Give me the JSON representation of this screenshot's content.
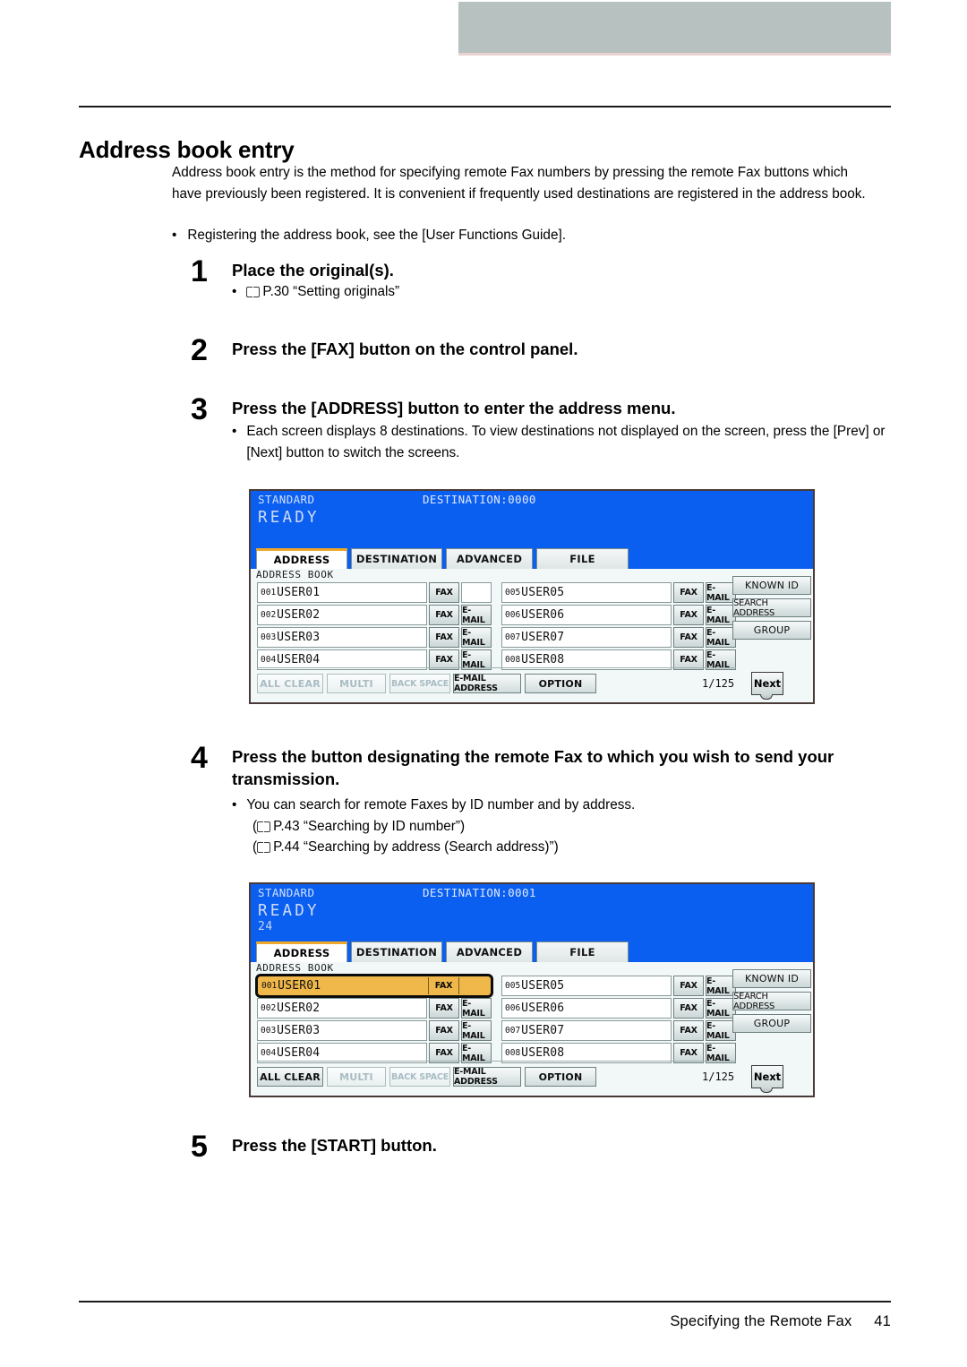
{
  "footer": {
    "label": "Specifying the Remote Fax",
    "page": "41"
  },
  "heading": "Address book entry",
  "intro": "Address book entry is the method for specifying remote Fax numbers by pressing the remote Fax buttons which have previously been registered. It is convenient if frequently used destinations are registered in the address book.",
  "intro_bullet": {
    "dot": "•",
    "text": "Registering the address book, see the [User Functions Guide]."
  },
  "steps": [
    {
      "num": "1",
      "title": "Place the original(s).",
      "bullets": [
        {
          "dot": "•",
          "ref": "P.30 “Setting originals”",
          "has_book": true
        }
      ]
    },
    {
      "num": "2",
      "title": "Press the [FAX] button on the control panel.",
      "bullets": []
    },
    {
      "num": "3",
      "title": "Press the [ADDRESS] button to enter the address menu.",
      "bullets": [
        {
          "dot": "•",
          "ref": "Each screen displays 8 destinations. To view destinations not displayed on the screen, press the [Prev] or [Next] button to switch the screens.",
          "has_book": false
        }
      ]
    },
    {
      "num": "4",
      "title": "Press the button designating the remote Fax to which you wish to send your transmission.",
      "bullets": [
        {
          "dot": "•",
          "ref": "You can search for remote Faxes by ID number and by address.",
          "has_book": false
        },
        {
          "dot": "",
          "ref": "P.43 “Searching by ID number”",
          "has_book": true,
          "paren": true
        },
        {
          "dot": "",
          "ref": "P.44 “Searching by address (Search address)”",
          "has_book": true,
          "paren": true
        }
      ]
    },
    {
      "num": "5",
      "title": "Press the [START] button.",
      "bullets": []
    }
  ],
  "colors": {
    "lcd_blue": "#0a5ef0",
    "lcd_face": "#f2f7f7",
    "tab_accent": "#f0a829",
    "selection": "#f0b74a",
    "header_bar": "#b6c1c0"
  },
  "panels": [
    {
      "status_left": "STANDARD",
      "destination": "DESTINATION:0000",
      "ready": "READY",
      "counter": "",
      "address_book_label": "ADDRESS BOOK",
      "tabs": [
        {
          "label": "ADDRESS",
          "active": true
        },
        {
          "label": "DESTINATION",
          "active": false
        },
        {
          "label": "ADVANCED",
          "active": false
        },
        {
          "label": "FILE",
          "active": false
        }
      ],
      "entries": [
        {
          "num": "001",
          "name": "USER01",
          "fax": "FAX",
          "email": "",
          "selected": false
        },
        {
          "num": "002",
          "name": "USER02",
          "fax": "FAX",
          "email": "E-MAIL",
          "selected": false
        },
        {
          "num": "003",
          "name": "USER03",
          "fax": "FAX",
          "email": "E-MAIL",
          "selected": false
        },
        {
          "num": "004",
          "name": "USER04",
          "fax": "FAX",
          "email": "E-MAIL",
          "selected": false
        },
        {
          "num": "005",
          "name": "USER05",
          "fax": "FAX",
          "email": "E-MAIL",
          "selected": false
        },
        {
          "num": "006",
          "name": "USER06",
          "fax": "FAX",
          "email": "E-MAIL",
          "selected": false
        },
        {
          "num": "007",
          "name": "USER07",
          "fax": "FAX",
          "email": "E-MAIL",
          "selected": false
        },
        {
          "num": "008",
          "name": "USER08",
          "fax": "FAX",
          "email": "E-MAIL",
          "selected": false
        }
      ],
      "side_buttons": [
        {
          "label": "KNOWN ID",
          "tight": false
        },
        {
          "label": "SEARCH ADDRESS",
          "tight": true
        },
        {
          "label": "GROUP",
          "tight": false
        }
      ],
      "toolbar": [
        {
          "label": "ALL CLEAR",
          "disabled": true,
          "small": false
        },
        {
          "label": "MULTI",
          "disabled": true,
          "small": false
        },
        {
          "label": "BACK SPACE",
          "disabled": true,
          "small": true
        },
        {
          "label": "E-MAIL ADDRESS",
          "disabled": false,
          "small": true
        },
        {
          "label": "OPTION",
          "disabled": false,
          "small": false
        }
      ],
      "page_indicator": "1/125",
      "next_label": "Next"
    },
    {
      "status_left": "STANDARD",
      "destination": "DESTINATION:0001",
      "ready": "READY",
      "counter": "24",
      "address_book_label": "ADDRESS BOOK",
      "tabs": [
        {
          "label": "ADDRESS",
          "active": true
        },
        {
          "label": "DESTINATION",
          "active": false
        },
        {
          "label": "ADVANCED",
          "active": false
        },
        {
          "label": "FILE",
          "active": false
        }
      ],
      "entries": [
        {
          "num": "001",
          "name": "USER01",
          "fax": "FAX",
          "email": "",
          "selected": true
        },
        {
          "num": "002",
          "name": "USER02",
          "fax": "FAX",
          "email": "E-MAIL",
          "selected": false
        },
        {
          "num": "003",
          "name": "USER03",
          "fax": "FAX",
          "email": "E-MAIL",
          "selected": false
        },
        {
          "num": "004",
          "name": "USER04",
          "fax": "FAX",
          "email": "E-MAIL",
          "selected": false
        },
        {
          "num": "005",
          "name": "USER05",
          "fax": "FAX",
          "email": "E-MAIL",
          "selected": false
        },
        {
          "num": "006",
          "name": "USER06",
          "fax": "FAX",
          "email": "E-MAIL",
          "selected": false
        },
        {
          "num": "007",
          "name": "USER07",
          "fax": "FAX",
          "email": "E-MAIL",
          "selected": false
        },
        {
          "num": "008",
          "name": "USER08",
          "fax": "FAX",
          "email": "E-MAIL",
          "selected": false
        }
      ],
      "side_buttons": [
        {
          "label": "KNOWN ID",
          "tight": false
        },
        {
          "label": "SEARCH ADDRESS",
          "tight": true
        },
        {
          "label": "GROUP",
          "tight": false
        }
      ],
      "toolbar": [
        {
          "label": "ALL CLEAR",
          "disabled": false,
          "small": false
        },
        {
          "label": "MULTI",
          "disabled": true,
          "small": false
        },
        {
          "label": "BACK SPACE",
          "disabled": true,
          "small": true
        },
        {
          "label": "E-MAIL ADDRESS",
          "disabled": false,
          "small": true
        },
        {
          "label": "OPTION",
          "disabled": false,
          "small": false
        }
      ],
      "page_indicator": "1/125",
      "next_label": "Next"
    }
  ]
}
